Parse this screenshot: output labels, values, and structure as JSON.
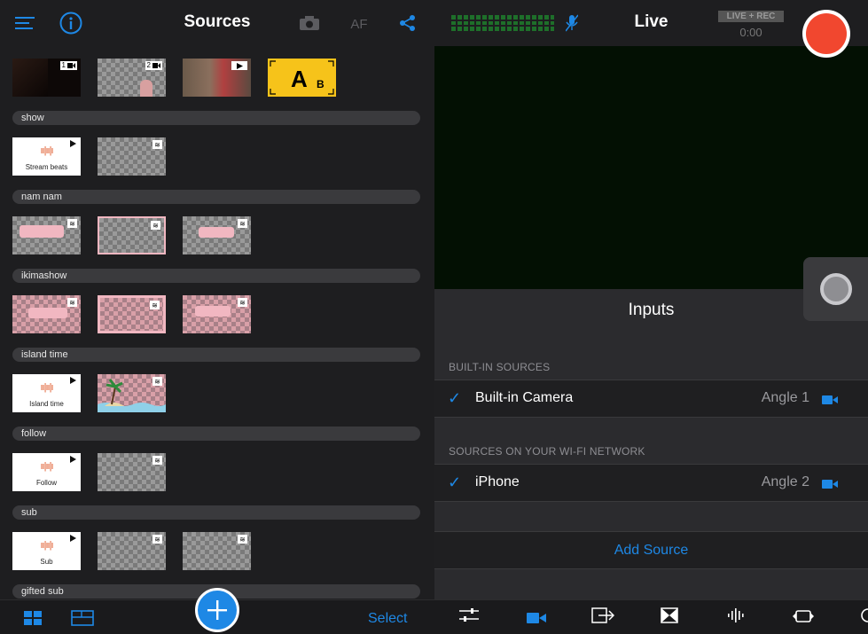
{
  "sources_panel": {
    "title": "Sources",
    "af_label": "AF",
    "select_label": "Select",
    "top_row": [
      {
        "badge": "1",
        "kind": "camera"
      },
      {
        "badge": "2",
        "kind": "camera"
      },
      {
        "badge": "",
        "kind": "video"
      },
      {
        "kind": "title",
        "letter_a": "A",
        "letter_b": "B"
      }
    ],
    "groups": [
      {
        "label": "show",
        "first_title": "Stream beats"
      },
      {
        "label": "nam nam"
      },
      {
        "label": "ikimashow"
      },
      {
        "label": "island time",
        "first_title": "Island time"
      },
      {
        "label": "follow",
        "first_title": "Follow"
      },
      {
        "label": "sub",
        "first_title": "Sub"
      },
      {
        "label": "gifted sub"
      }
    ]
  },
  "live_panel": {
    "title": "Live",
    "status_badge": "LIVE + REC",
    "timer": "0:00",
    "inputs_title": "Inputs",
    "builtin_header": "BUILT-IN SOURCES",
    "wifi_header": "SOURCES ON YOUR WI-FI NETWORK",
    "sources": [
      {
        "name": "Built-in Camera",
        "angle": "Angle 1"
      },
      {
        "name": "iPhone",
        "angle": "Angle 2"
      }
    ],
    "add_source": "Add Source"
  },
  "colors": {
    "accent": "#1e88e5",
    "record": "#f1472f",
    "title_gold": "#f6c31a"
  }
}
